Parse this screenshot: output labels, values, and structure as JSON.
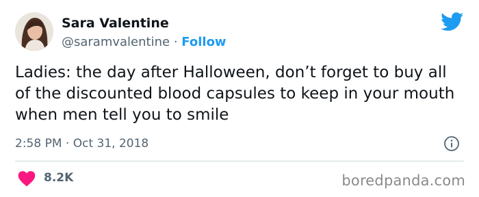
{
  "author": {
    "name": "Sara Valentine",
    "handle": "@saramvalentine",
    "separator": "·",
    "follow_label": "Follow"
  },
  "tweet": {
    "text": "Ladies: the day after Halloween, don’t forget to buy all of the discounted blood capsules to keep in your mouth when men tell you to smile",
    "time": "2:58 PM",
    "separator": "·",
    "date": "Oct 31, 2018",
    "likes": "8.2K"
  },
  "watermark": "boredpanda.com",
  "colors": {
    "accent": "#1d9bf0",
    "heart": "#f91880",
    "muted": "#536471",
    "text": "#0f1419"
  },
  "icons": {
    "platform": "twitter-bird-icon",
    "info": "info-icon",
    "like": "heart-icon"
  }
}
